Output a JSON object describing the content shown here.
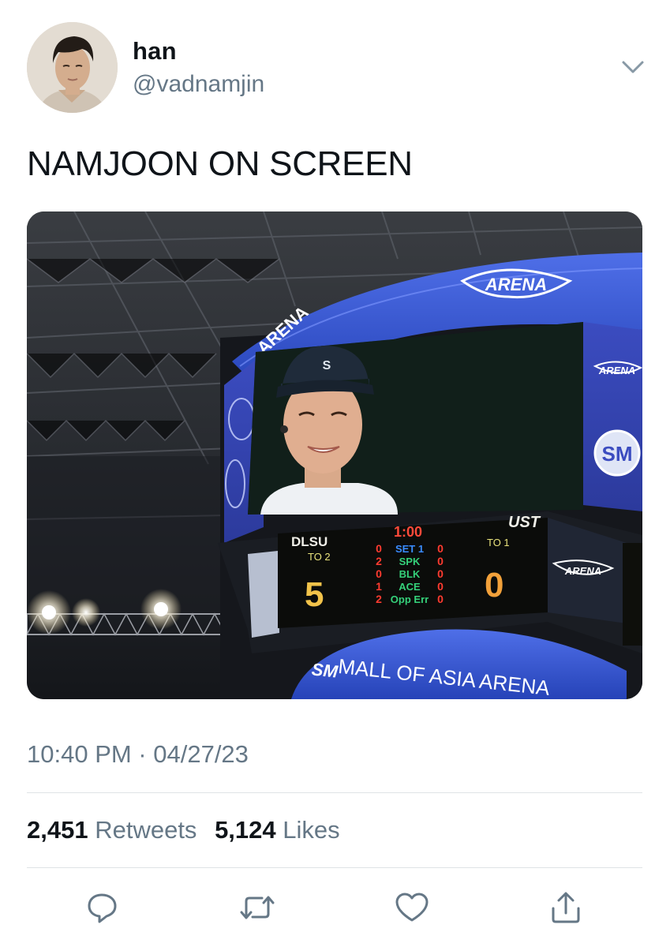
{
  "author": {
    "display_name": "han",
    "handle": "@vadnamjin",
    "avatar_icon": "profile-photo"
  },
  "tweet": {
    "text": "NAMJOON ON SCREEN",
    "timestamp": "10:40 PM · 04/27/23"
  },
  "media": {
    "scoreboard": {
      "team_home": "DLSU",
      "team_away": "UST",
      "clock": "1:00",
      "home_timeouts": "TO 2",
      "away_timeouts": "TO 1",
      "home_score": "5",
      "away_score": "0",
      "stat_labels": [
        "SET 1",
        "SPK",
        "BLK",
        "ACE",
        "Opp Err"
      ],
      "home_stats": [
        "0",
        "2",
        "0",
        "1",
        "2"
      ],
      "away_stats": [
        "0",
        "0",
        "0",
        "0",
        "0"
      ]
    },
    "arena_logo": "ARENA",
    "arena_banner": "MALL OF ASIA ARENA",
    "arena_banner_prefix": "SM",
    "arena_partial": "ARENA",
    "sm_logo": "SM"
  },
  "stats": {
    "retweets_count": "2,451",
    "retweets_label": "Retweets",
    "likes_count": "5,124",
    "likes_label": "Likes"
  },
  "colors": {
    "secondary_text": "#657786",
    "divider": "#dfe3e6",
    "icon": "#657786"
  },
  "icons": {
    "menu": "chevron-down-icon",
    "reply": "reply-icon",
    "retweet": "retweet-icon",
    "like": "heart-icon",
    "share": "share-icon"
  }
}
